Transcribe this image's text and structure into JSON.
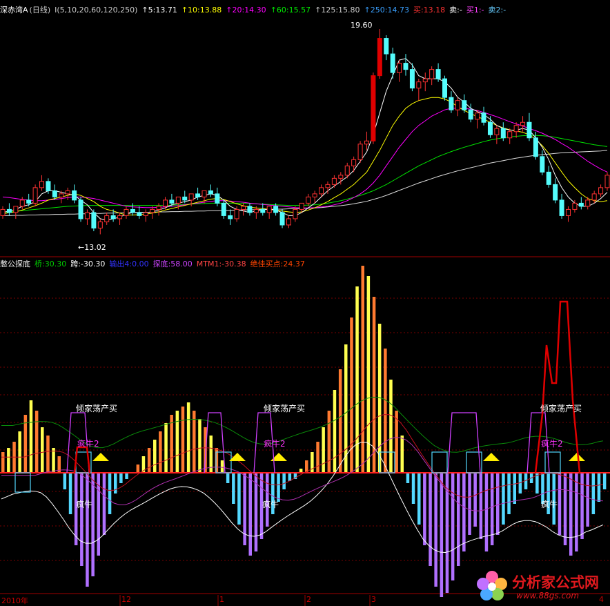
{
  "top_header": {
    "name": "深赤湾A",
    "period": "(日线)",
    "params": "I(5,10,20,60,120,250)",
    "ma5": "↑5:13.71",
    "ma10": "↑10:13.88",
    "ma20": "↑20:14.30",
    "ma60": "↑60:15.57",
    "ma125": "↑125:15.80",
    "ma250": "↑250:14.73",
    "buy": "买:13.18",
    "sell": "卖:-",
    "buy1": "买1:-",
    "sell2": "卖2:-"
  },
  "top_annotations": {
    "high": "19.60",
    "low": "←13.02"
  },
  "bottom_header": {
    "name": "憋公探底",
    "bridge": "桥:30.30",
    "jump": "跨:-30.30",
    "output4": "输出4:0.00",
    "tandi": "探底:58.00",
    "mtm1": "MTM1:-30.38",
    "best_buy": "绝佳买点:24.37"
  },
  "signal_labels": {
    "qingjia": "倾家荡产买",
    "fengniu2": "疯牛2",
    "fengniu": "疯牛"
  },
  "x_axis": {
    "ticks": [
      "2010年",
      "12",
      "1",
      "2",
      "3",
      "4"
    ]
  },
  "watermark": {
    "title": "分析家公式网",
    "url": "www.88gs.com"
  },
  "colors": {
    "up": "#ff3232",
    "down": "#54fcfc",
    "ma5": "#ffffff",
    "ma10": "#ffff00",
    "ma20": "#ff00ff",
    "ma60": "#00e600",
    "hist_pos": "#ff7a30",
    "hist_pos_hi": "#ffff50",
    "hist_neg": "#54d8ff",
    "hist_neg_hi": "#b070ff",
    "grid": "#7a0000"
  },
  "chart_data": [
    {
      "type": "candlestick",
      "title": "深赤湾A (日线)",
      "ylim": [
        12.5,
        20.0
      ],
      "ohlc": [
        [
          13.6,
          13.9,
          13.5,
          13.8
        ],
        [
          13.8,
          14.0,
          13.6,
          13.7
        ],
        [
          13.7,
          13.9,
          13.5,
          13.9
        ],
        [
          13.9,
          14.2,
          13.8,
          14.1
        ],
        [
          14.1,
          14.3,
          13.9,
          14.0
        ],
        [
          14.0,
          14.6,
          13.9,
          14.5
        ],
        [
          14.5,
          14.9,
          14.4,
          14.7
        ],
        [
          14.7,
          14.8,
          14.3,
          14.4
        ],
        [
          14.4,
          14.6,
          14.1,
          14.2
        ],
        [
          14.2,
          14.4,
          14.0,
          14.3
        ],
        [
          14.3,
          14.5,
          14.1,
          14.4
        ],
        [
          14.4,
          14.6,
          14.0,
          14.1
        ],
        [
          14.1,
          14.2,
          13.4,
          13.5
        ],
        [
          13.5,
          13.8,
          13.3,
          13.7
        ],
        [
          13.7,
          13.8,
          13.1,
          13.2
        ],
        [
          13.2,
          13.5,
          13.0,
          13.4
        ],
        [
          13.4,
          13.7,
          13.3,
          13.6
        ],
        [
          13.6,
          13.8,
          13.4,
          13.5
        ],
        [
          13.5,
          13.7,
          13.3,
          13.6
        ],
        [
          13.6,
          13.9,
          13.5,
          13.8
        ],
        [
          13.8,
          14.0,
          13.6,
          13.7
        ],
        [
          13.7,
          13.9,
          13.5,
          13.6
        ],
        [
          13.6,
          13.8,
          13.4,
          13.7
        ],
        [
          13.7,
          13.9,
          13.5,
          13.8
        ],
        [
          13.8,
          14.0,
          13.6,
          13.9
        ],
        [
          13.9,
          14.2,
          13.8,
          14.1
        ],
        [
          14.1,
          14.3,
          13.9,
          14.0
        ],
        [
          14.0,
          14.2,
          13.8,
          14.2
        ],
        [
          14.2,
          14.4,
          14.0,
          14.1
        ],
        [
          14.1,
          14.3,
          13.9,
          14.3
        ],
        [
          14.3,
          14.5,
          14.1,
          14.2
        ],
        [
          14.2,
          14.4,
          14.0,
          14.4
        ],
        [
          14.4,
          14.6,
          14.2,
          14.3
        ],
        [
          14.3,
          14.5,
          13.9,
          14.0
        ],
        [
          14.0,
          14.1,
          13.5,
          13.6
        ],
        [
          13.6,
          13.8,
          13.3,
          13.5
        ],
        [
          13.5,
          13.9,
          13.4,
          13.8
        ],
        [
          13.8,
          14.0,
          13.6,
          13.9
        ],
        [
          13.9,
          14.0,
          13.6,
          13.7
        ],
        [
          13.7,
          13.9,
          13.5,
          13.8
        ],
        [
          13.8,
          14.0,
          13.6,
          13.7
        ],
        [
          13.7,
          13.9,
          13.5,
          13.9
        ],
        [
          13.9,
          14.0,
          13.6,
          13.7
        ],
        [
          13.7,
          13.8,
          13.2,
          13.3
        ],
        [
          13.3,
          13.6,
          13.2,
          13.5
        ],
        [
          13.5,
          13.9,
          13.4,
          13.8
        ],
        [
          13.8,
          14.0,
          13.7,
          14.0
        ],
        [
          14.0,
          14.3,
          13.9,
          14.2
        ],
        [
          14.2,
          14.4,
          14.0,
          14.3
        ],
        [
          14.3,
          14.6,
          14.2,
          14.5
        ],
        [
          14.5,
          14.7,
          14.3,
          14.6
        ],
        [
          14.6,
          14.9,
          14.5,
          14.8
        ],
        [
          14.8,
          15.0,
          14.6,
          14.9
        ],
        [
          14.9,
          15.3,
          14.8,
          15.2
        ],
        [
          15.2,
          15.5,
          15.0,
          15.4
        ],
        [
          15.4,
          16.0,
          15.3,
          15.9
        ],
        [
          15.9,
          16.3,
          15.7,
          16.0
        ],
        [
          16.0,
          18.2,
          15.9,
          18.1
        ],
        [
          18.1,
          19.6,
          18.0,
          19.3
        ],
        [
          19.3,
          19.4,
          18.6,
          18.8
        ],
        [
          18.8,
          19.0,
          18.0,
          18.2
        ],
        [
          18.2,
          18.6,
          17.9,
          18.5
        ],
        [
          18.5,
          18.8,
          18.1,
          18.3
        ],
        [
          18.3,
          18.5,
          17.6,
          17.7
        ],
        [
          17.7,
          18.0,
          17.3,
          17.9
        ],
        [
          17.9,
          18.2,
          17.6,
          18.0
        ],
        [
          18.0,
          18.4,
          17.8,
          18.3
        ],
        [
          18.3,
          18.5,
          17.9,
          18.0
        ],
        [
          18.0,
          18.1,
          17.3,
          17.4
        ],
        [
          17.4,
          17.6,
          16.9,
          17.0
        ],
        [
          17.0,
          17.4,
          16.8,
          17.3
        ],
        [
          17.3,
          17.5,
          16.9,
          17.0
        ],
        [
          17.0,
          17.2,
          16.6,
          16.7
        ],
        [
          16.7,
          17.0,
          16.4,
          16.9
        ],
        [
          16.9,
          17.1,
          16.5,
          16.6
        ],
        [
          16.6,
          16.8,
          16.1,
          16.2
        ],
        [
          16.2,
          16.5,
          15.9,
          16.4
        ],
        [
          16.4,
          16.6,
          16.0,
          16.1
        ],
        [
          16.1,
          16.4,
          15.9,
          16.3
        ],
        [
          16.3,
          16.6,
          16.1,
          16.5
        ],
        [
          16.5,
          16.8,
          16.3,
          16.6
        ],
        [
          16.6,
          16.9,
          16.0,
          16.1
        ],
        [
          16.1,
          16.3,
          15.4,
          15.5
        ],
        [
          15.5,
          15.7,
          14.9,
          15.0
        ],
        [
          15.0,
          15.2,
          14.5,
          14.6
        ],
        [
          14.6,
          14.8,
          14.0,
          14.1
        ],
        [
          14.1,
          14.3,
          13.5,
          13.6
        ],
        [
          13.6,
          13.9,
          13.4,
          13.8
        ],
        [
          13.8,
          14.1,
          13.7,
          14.0
        ],
        [
          14.0,
          14.2,
          13.8,
          13.9
        ],
        [
          13.9,
          14.2,
          13.8,
          14.1
        ],
        [
          14.1,
          14.4,
          14.0,
          14.3
        ],
        [
          14.3,
          14.6,
          14.2,
          14.5
        ],
        [
          14.5,
          15.0,
          14.4,
          14.9
        ]
      ],
      "ma5": [
        13.7,
        13.75,
        13.8,
        13.9,
        13.95,
        14.05,
        14.3,
        14.4,
        14.4,
        14.35,
        14.3,
        14.25,
        14.1,
        13.95,
        13.7,
        13.5,
        13.45,
        13.5,
        13.55,
        13.65,
        13.7,
        13.7,
        13.7,
        13.72,
        13.78,
        13.85,
        13.95,
        14.0,
        14.05,
        14.1,
        14.2,
        14.25,
        14.3,
        14.25,
        14.1,
        13.9,
        13.8,
        13.75,
        13.7,
        13.75,
        13.8,
        13.8,
        13.78,
        13.7,
        13.6,
        13.6,
        13.7,
        13.85,
        14.0,
        14.2,
        14.4,
        14.55,
        14.7,
        14.85,
        15.05,
        15.35,
        15.65,
        16.2,
        16.9,
        17.6,
        18.1,
        18.6,
        18.65,
        18.45,
        18.1,
        18.0,
        18.0,
        18.0,
        17.9,
        17.7,
        17.4,
        17.25,
        17.05,
        16.95,
        16.85,
        16.7,
        16.5,
        16.4,
        16.35,
        16.35,
        16.4,
        16.35,
        16.1,
        15.8,
        15.4,
        14.9,
        14.5,
        14.2,
        14.0,
        13.9,
        13.9,
        14.0,
        14.15,
        14.35
      ],
      "ma10": [
        13.65,
        13.7,
        13.72,
        13.78,
        13.85,
        13.92,
        14.0,
        14.1,
        14.15,
        14.2,
        14.25,
        14.3,
        14.25,
        14.15,
        14.05,
        13.9,
        13.8,
        13.75,
        13.68,
        13.62,
        13.62,
        13.63,
        13.65,
        13.68,
        13.72,
        13.78,
        13.83,
        13.88,
        13.93,
        13.98,
        14.03,
        14.08,
        14.13,
        14.15,
        14.12,
        14.05,
        13.98,
        13.92,
        13.87,
        13.85,
        13.83,
        13.8,
        13.78,
        13.75,
        13.72,
        13.7,
        13.72,
        13.78,
        13.85,
        13.95,
        14.05,
        14.18,
        14.3,
        14.45,
        14.6,
        14.8,
        15.0,
        15.35,
        15.7,
        16.1,
        16.5,
        16.8,
        17.05,
        17.2,
        17.3,
        17.35,
        17.4,
        17.4,
        17.35,
        17.25,
        17.1,
        16.98,
        16.88,
        16.78,
        16.7,
        16.6,
        16.5,
        16.42,
        16.36,
        16.32,
        16.28,
        16.2,
        16.05,
        15.85,
        15.6,
        15.3,
        15.0,
        14.72,
        14.5,
        14.3,
        14.15,
        14.08,
        14.05,
        14.08
      ],
      "ma20": [
        14.2,
        14.18,
        14.15,
        14.12,
        14.1,
        14.08,
        14.08,
        14.1,
        14.12,
        14.15,
        14.18,
        14.2,
        14.2,
        14.18,
        14.15,
        14.1,
        14.05,
        14.0,
        13.95,
        13.9,
        13.88,
        13.87,
        13.86,
        13.86,
        13.87,
        13.88,
        13.9,
        13.92,
        13.95,
        13.98,
        14.0,
        14.03,
        14.06,
        14.08,
        14.08,
        14.07,
        14.05,
        14.03,
        14.0,
        13.98,
        13.96,
        13.94,
        13.92,
        13.9,
        13.88,
        13.86,
        13.85,
        13.85,
        13.86,
        13.88,
        13.9,
        13.95,
        14.0,
        14.08,
        14.18,
        14.3,
        14.45,
        14.65,
        14.9,
        15.2,
        15.5,
        15.8,
        16.05,
        16.3,
        16.5,
        16.65,
        16.8,
        16.9,
        17.0,
        17.05,
        17.05,
        17.05,
        17.02,
        16.98,
        16.92,
        16.85,
        16.78,
        16.7,
        16.62,
        16.55,
        16.48,
        16.4,
        16.33,
        16.25,
        16.15,
        16.05,
        15.92,
        15.8,
        15.65,
        15.5,
        15.35,
        15.22,
        15.1,
        15.0
      ],
      "ma60": [
        13.7,
        13.72,
        13.74,
        13.76,
        13.78,
        13.8,
        13.82,
        13.84,
        13.86,
        13.88,
        13.9,
        13.91,
        13.92,
        13.93,
        13.93,
        13.93,
        13.93,
        13.93,
        13.93,
        13.93,
        13.93,
        13.93,
        13.93,
        13.93,
        13.93,
        13.93,
        13.94,
        13.95,
        13.96,
        13.97,
        13.98,
        13.99,
        14.0,
        14.0,
        14.0,
        14.0,
        14.0,
        14.0,
        13.99,
        13.98,
        13.97,
        13.96,
        13.95,
        13.94,
        13.93,
        13.93,
        13.93,
        13.94,
        13.95,
        13.97,
        14.0,
        14.04,
        14.08,
        14.13,
        14.19,
        14.25,
        14.32,
        14.4,
        14.5,
        14.6,
        14.72,
        14.84,
        14.96,
        15.08,
        15.2,
        15.3,
        15.4,
        15.5,
        15.58,
        15.66,
        15.73,
        15.8,
        15.86,
        15.92,
        15.98,
        16.03,
        16.07,
        16.1,
        16.13,
        16.15,
        16.17,
        16.18,
        16.18,
        16.17,
        16.15,
        16.12,
        16.08,
        16.04,
        16.0,
        15.96,
        15.92,
        15.88,
        15.85,
        15.82
      ],
      "ma120": [
        13.6,
        13.6,
        13.61,
        13.61,
        13.62,
        13.62,
        13.63,
        13.63,
        13.64,
        13.64,
        13.65,
        13.65,
        13.66,
        13.66,
        13.67,
        13.67,
        13.68,
        13.68,
        13.69,
        13.69,
        13.7,
        13.7,
        13.71,
        13.71,
        13.72,
        13.72,
        13.73,
        13.73,
        13.74,
        13.74,
        13.75,
        13.75,
        13.76,
        13.76,
        13.77,
        13.77,
        13.78,
        13.78,
        13.79,
        13.79,
        13.8,
        13.8,
        13.81,
        13.81,
        13.82,
        13.82,
        13.83,
        13.84,
        13.85,
        13.86,
        13.88,
        13.9,
        13.92,
        13.95,
        13.98,
        14.02,
        14.06,
        14.12,
        14.18,
        14.25,
        14.33,
        14.41,
        14.49,
        14.57,
        14.65,
        14.72,
        14.79,
        14.86,
        14.92,
        14.98,
        15.04,
        15.09,
        15.14,
        15.19,
        15.24,
        15.29,
        15.33,
        15.37,
        15.41,
        15.45,
        15.48,
        15.51,
        15.54,
        15.56,
        15.58,
        15.6,
        15.62,
        15.63,
        15.64,
        15.65,
        15.66,
        15.67,
        15.68,
        15.7
      ]
    },
    {
      "type": "bar",
      "title": "憋公探底",
      "ylim": [
        -60,
        100
      ],
      "values": [
        10,
        12,
        15,
        20,
        28,
        35,
        30,
        22,
        18,
        12,
        8,
        -8,
        -20,
        -35,
        -45,
        -55,
        -50,
        -40,
        -30,
        -20,
        -10,
        -5,
        -3,
        0,
        4,
        8,
        12,
        16,
        20,
        24,
        28,
        30,
        32,
        34,
        30,
        26,
        22,
        18,
        12,
        6,
        -5,
        -15,
        -25,
        -35,
        -40,
        -38,
        -32,
        -26,
        -20,
        -14,
        -8,
        -4,
        -3,
        2,
        6,
        10,
        15,
        22,
        30,
        40,
        50,
        62,
        75,
        90,
        100,
        95,
        85,
        72,
        60,
        45,
        30,
        18,
        -5,
        -15,
        -25,
        -35,
        -45,
        -55,
        -60,
        -58,
        -52,
        -45,
        -38,
        -30,
        -26,
        -32,
        -38,
        -35,
        -30,
        -25,
        -20,
        -15,
        -10,
        -8,
        -5,
        -10,
        -15,
        -20,
        -25,
        -30,
        -35,
        -40,
        -38,
        -32,
        -26,
        -20,
        -14,
        -8
      ],
      "bridge": 30.3,
      "jump": -30.3,
      "output4": 0.0,
      "tandi": 58.0,
      "mtm1": -30.38,
      "best_buy": 24.37
    }
  ]
}
